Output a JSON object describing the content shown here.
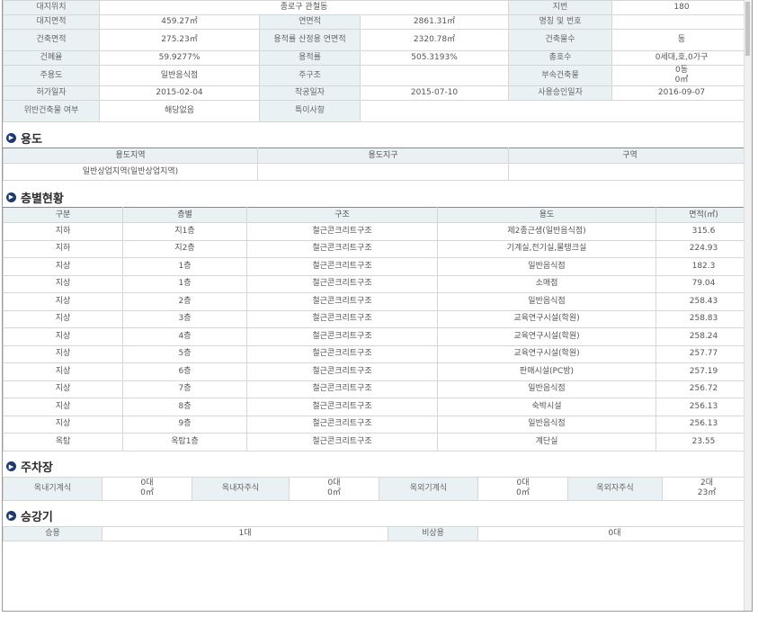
{
  "summary": {
    "rows": [
      [
        {
          "t": "대지위치",
          "l": 1
        },
        {
          "t": "종로구 관철동",
          "span": 3
        },
        {
          "t": "지번",
          "l": 1
        },
        {
          "t": "180"
        }
      ],
      [
        {
          "t": "대지면적",
          "l": 1
        },
        {
          "t": "459.27㎡"
        },
        {
          "t": "연면적",
          "l": 1
        },
        {
          "t": "2861.31㎡"
        },
        {
          "t": "명칭 및 번호",
          "l": 1
        },
        {
          "t": ""
        }
      ],
      [
        {
          "t": "건축면적",
          "l": 1
        },
        {
          "t": "275.23㎡"
        },
        {
          "t": "용적률 산정용 연면적",
          "l": 1
        },
        {
          "t": "2320.78㎡"
        },
        {
          "t": "건축물수",
          "l": 1
        },
        {
          "t": "동"
        }
      ],
      [
        {
          "t": "건폐율",
          "l": 1
        },
        {
          "t": "59.9277%"
        },
        {
          "t": "용적률",
          "l": 1
        },
        {
          "t": "505.3193%"
        },
        {
          "t": "총호수",
          "l": 1
        },
        {
          "t": "0세대,호,0가구"
        }
      ],
      [
        {
          "t": "주용도",
          "l": 1
        },
        {
          "t": "일반음식점"
        },
        {
          "t": "주구조",
          "l": 1
        },
        {
          "t": ""
        },
        {
          "t": "부속건축물",
          "l": 1
        },
        {
          "t": "0동\n0㎡"
        }
      ],
      [
        {
          "t": "허가일자",
          "l": 1
        },
        {
          "t": "2015-02-04"
        },
        {
          "t": "착공일자",
          "l": 1
        },
        {
          "t": "2015-07-10"
        },
        {
          "t": "사용승인일자",
          "l": 1
        },
        {
          "t": "2016-09-07"
        }
      ],
      [
        {
          "t": "위반건축물 여부",
          "l": 1
        },
        {
          "t": "해당없음"
        },
        {
          "t": "특이사항",
          "l": 1
        },
        {
          "t": "",
          "span": 3
        }
      ]
    ]
  },
  "zoning": {
    "title": "용도",
    "headers": [
      "용도지역",
      "용도지구",
      "구역"
    ],
    "values": [
      "일반상업지역(일반상업지역)",
      "",
      ""
    ]
  },
  "floors": {
    "title": "층별현황",
    "headers": [
      "구분",
      "층별",
      "구조",
      "용도",
      "면적(㎡)"
    ],
    "rows": [
      [
        "지하",
        "지1층",
        "철근콘크리트구조",
        "제2종근생(일반음식점)",
        "315.6"
      ],
      [
        "지하",
        "지2층",
        "철근콘크리트구조",
        "기계실,전기실,물탱크실",
        "224.93"
      ],
      [
        "지상",
        "1층",
        "철근콘크리트구조",
        "일반음식점",
        "182.3"
      ],
      [
        "지상",
        "1층",
        "철근콘크리트구조",
        "소매점",
        "79.04"
      ],
      [
        "지상",
        "2층",
        "철근콘크리트구조",
        "일반음식점",
        "258.43"
      ],
      [
        "지상",
        "3층",
        "철근콘크리트구조",
        "교육연구시설(학원)",
        "258.83"
      ],
      [
        "지상",
        "4층",
        "철근콘크리트구조",
        "교육연구시설(학원)",
        "258.24"
      ],
      [
        "지상",
        "5층",
        "철근콘크리트구조",
        "교육연구시설(학원)",
        "257.77"
      ],
      [
        "지상",
        "6층",
        "철근콘크리트구조",
        "판매시설(PC방)",
        "257.19"
      ],
      [
        "지상",
        "7층",
        "철근콘크리트구조",
        "일반음식점",
        "256.72"
      ],
      [
        "지상",
        "8층",
        "철근콘크리트구조",
        "숙박시설",
        "256.13"
      ],
      [
        "지상",
        "9층",
        "철근콘크리트구조",
        "일반음식점",
        "256.13"
      ],
      [
        "옥탑",
        "옥탑1층",
        "철근콘크리트구조",
        "계단실",
        "23.55"
      ]
    ]
  },
  "parking": {
    "title": "주차장",
    "items": [
      {
        "label": "옥내기계식",
        "value": "0대\n0㎡"
      },
      {
        "label": "옥내자주식",
        "value": "0대\n0㎡"
      },
      {
        "label": "옥외기계식",
        "value": "0대\n0㎡"
      },
      {
        "label": "옥외자주식",
        "value": "2대\n23㎡"
      }
    ]
  },
  "elevator": {
    "title": "승강기",
    "items": [
      {
        "label": "승용",
        "value": "1대"
      },
      {
        "label": "비상용",
        "value": "0대"
      }
    ]
  },
  "icons": {
    "section": "chevron-right-icon"
  },
  "colors": {
    "accent": "#1d3b73",
    "header_bg": "#eaf1f5"
  }
}
